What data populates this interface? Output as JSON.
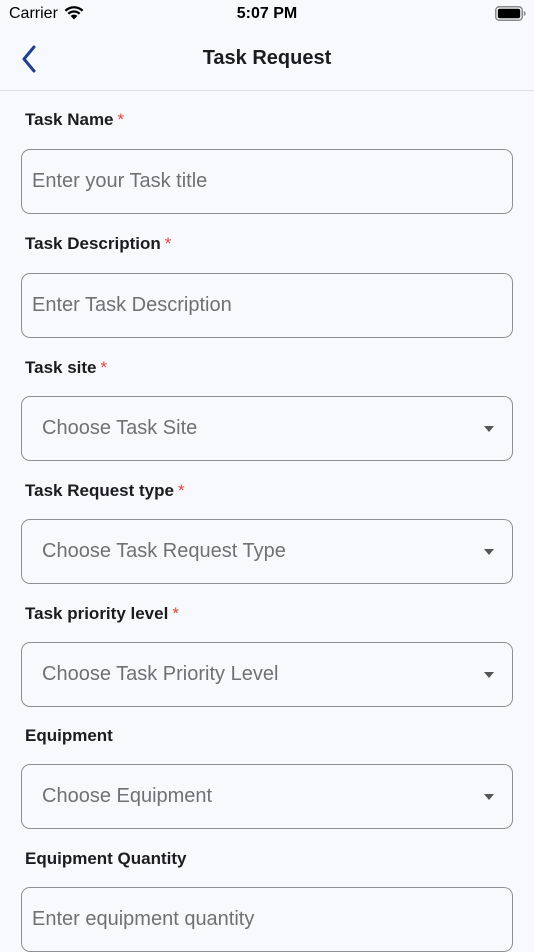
{
  "status_bar": {
    "carrier": "Carrier",
    "time": "5:07 PM"
  },
  "nav": {
    "title": "Task Request",
    "back_icon": "chevron-left-icon"
  },
  "colors": {
    "accent": "#1f3f8f",
    "required": "#e0453f",
    "border": "#8e8e93",
    "background": "#f8f9fc"
  },
  "form": {
    "required_mark": "*",
    "task_name": {
      "label": "Task Name",
      "placeholder": "Enter your Task title",
      "value": ""
    },
    "task_description": {
      "label": "Task Description",
      "placeholder": "Enter Task Description",
      "value": ""
    },
    "task_site": {
      "label": "Task site",
      "selected": "Choose Task Site"
    },
    "task_request_type": {
      "label": "Task Request type",
      "selected": "Choose Task Request Type"
    },
    "task_priority_level": {
      "label": "Task priority level",
      "selected": "Choose Task Priority Level"
    },
    "equipment": {
      "label": "Equipment",
      "selected": "Choose Equipment"
    },
    "equipment_quantity": {
      "label": "Equipment Quantity",
      "placeholder": "Enter equipment quantity",
      "value": ""
    }
  }
}
